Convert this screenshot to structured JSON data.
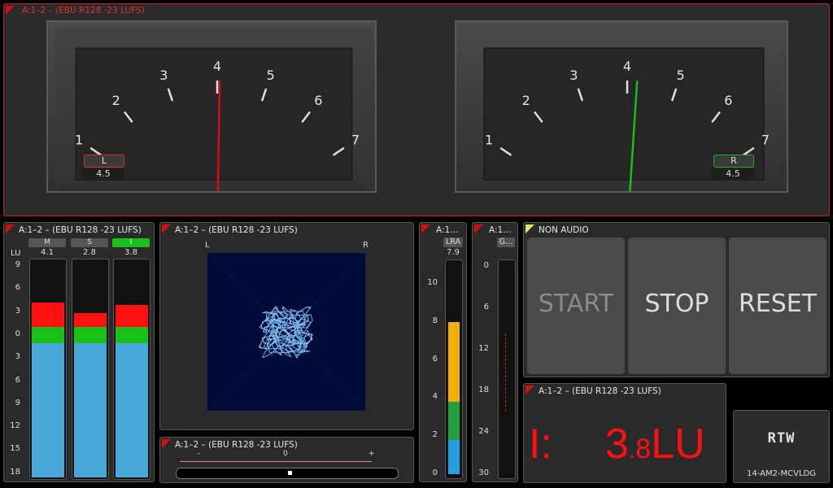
{
  "vu_panel": {
    "title": "A:1–2 – (EBU R128 -23 LUFS)"
  },
  "vu_left": {
    "scale": [
      "1",
      "2",
      "3",
      "4",
      "5",
      "6",
      "7"
    ],
    "channel": "L",
    "value": "4.5",
    "needle_color": "#d01010",
    "needle_level": 4.05
  },
  "vu_right": {
    "scale": [
      "1",
      "2",
      "3",
      "4",
      "5",
      "6",
      "7"
    ],
    "channel": "R",
    "value": "4.5",
    "needle_color": "#18c018",
    "needle_level": 4.2
  },
  "loudness_bars": {
    "title": "A:1–2 – (EBU R128 -23 LUFS)",
    "unit": "LU",
    "scale": [
      "9",
      "6",
      "3",
      "0",
      "3",
      "6",
      "9",
      "12",
      "15",
      "18"
    ],
    "meters": [
      {
        "label": "M",
        "value": "4.1",
        "lu": 4.1,
        "active": false
      },
      {
        "label": "S",
        "value": "2.8",
        "lu": 2.8,
        "active": false
      },
      {
        "label": "I",
        "value": "3.8",
        "lu": 3.8,
        "active": true
      }
    ]
  },
  "goniometer": {
    "title": "A:1–2 – (EBU R128 -23 LUFS)",
    "left_label": "L",
    "right_label": "R"
  },
  "correlation": {
    "title": "A:1–2 – (EBU R128 -23 LUFS)",
    "minus": "–",
    "zero": "0",
    "plus": "+",
    "value": 0.02
  },
  "lra": {
    "title": "A:1…",
    "label": "LRA",
    "value": "7.9",
    "scale": [
      "10",
      "8",
      "6",
      "4",
      "2",
      "0"
    ],
    "segments": [
      {
        "color": "#f0b000",
        "from": 3.8,
        "to": 8
      },
      {
        "color": "#20a040",
        "from": 1.8,
        "to": 3.8
      },
      {
        "color": "#20a0e0",
        "from": 0,
        "to": 1.8
      }
    ]
  },
  "gain": {
    "title": "A:1…",
    "label": "G…",
    "scale": [
      "0",
      "6",
      "12",
      "18",
      "24",
      "30"
    ]
  },
  "control": {
    "title": "NON AUDIO",
    "start": "START",
    "stop": "STOP",
    "reset": "RESET"
  },
  "integrated": {
    "title": "A:1–2 – (EBU R128 -23 LUFS)",
    "prefix": "I:",
    "big": "3",
    "dot": ".",
    "small": "8",
    "unit": "LU"
  },
  "logo": {
    "brand": "RTW",
    "device": "14-AM2-MCVLDG"
  },
  "colors": {
    "red": "#ff1010",
    "green": "#18c018",
    "blue": "#4aa8d8",
    "accent_red": "#c81e1e"
  }
}
